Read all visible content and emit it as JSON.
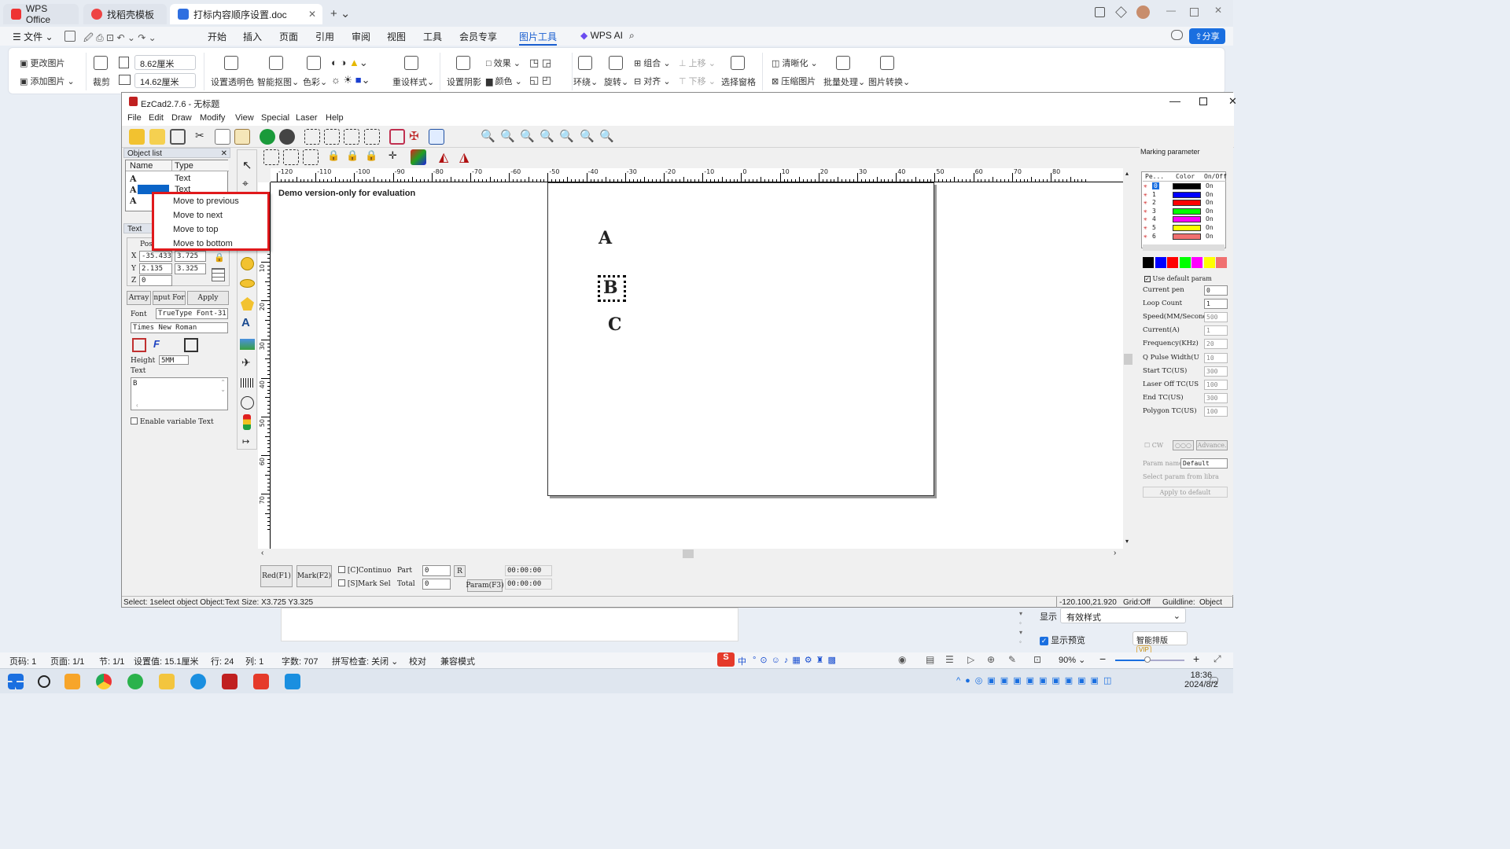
{
  "wps": {
    "tabs": [
      "WPS Office",
      "找稻壳模板",
      "打标内容顺序设置.doc"
    ],
    "menu_left": [
      "文件"
    ],
    "menu": [
      "开始",
      "插入",
      "页面",
      "引用",
      "审阅",
      "视图",
      "工具",
      "会员专享",
      "图片工具"
    ],
    "ai_label": "WPS AI",
    "share_label": "分享",
    "ribbon": {
      "change_image": "更改图片",
      "add_image": "添加图片",
      "crop": "裁剪",
      "width": "8.62厘米",
      "height": "14.62厘米",
      "set_transparent": "设置透明色",
      "smart_cutout": "智能抠图",
      "color_effect": "色彩",
      "effect": "效果",
      "color": "颜色",
      "preset_style": "重设样式",
      "set_shadow": "设置阴影",
      "wrap": "环绕",
      "rotate": "旋转",
      "group": "组合",
      "align": "对齐",
      "move_up": "上移",
      "move_down": "下移",
      "selection_pane": "选择窗格",
      "sharpen": "清晰化",
      "compress": "压缩图片",
      "batch": "批量处理",
      "convert": "图片转换"
    },
    "display_label": "显示",
    "display_value": "有效样式",
    "show_preview": "显示预览",
    "smart_layout": "智能排版",
    "vip": "VIP"
  },
  "ezcad": {
    "title": "EzCad2.7.6 - 无标题",
    "menu": [
      "File",
      "Edit",
      "Draw",
      "Modify",
      "View",
      "Special",
      "Laser",
      "Help"
    ],
    "object_list_title": "Object list",
    "columns": [
      "Name",
      "Type"
    ],
    "objects": [
      {
        "name": "A",
        "type": "Text"
      },
      {
        "name": "A",
        "type": "Text"
      },
      {
        "name": "A",
        "type": ""
      }
    ],
    "context_menu": [
      "Move to previous",
      "Move to next",
      "Move to top",
      "Move to bottom"
    ],
    "text_panel_title": "Text",
    "pos_label": "Pos",
    "x_label": "X",
    "y_label": "Y",
    "z_label": "Z",
    "x_val": "-35.433",
    "y_val": "2.135",
    "z_val": "0",
    "w_val": "3.725",
    "h_val": "3.325",
    "array_btn": "Array",
    "input_btn": "nput For",
    "apply_btn": "Apply",
    "font_label": "Font",
    "font_type": "TrueType Font-31",
    "font_name": "Times New Roman",
    "height_label": "Height",
    "height_val": "5MM",
    "text_label": "Text",
    "text_val": "B",
    "enable_var": "Enable variable Text",
    "demo_text": "Demo version-only for evaluation",
    "letters": [
      "A",
      "B",
      "C"
    ],
    "ruler_top": [
      "-120",
      "-110",
      "-100",
      "-90",
      "-80",
      "-70",
      "-60",
      "-50",
      "-40",
      "-30",
      "-20",
      "-10",
      "0",
      "10",
      "20",
      "30",
      "40",
      "50",
      "60",
      "70",
      "80"
    ],
    "ruler_left": [
      "0",
      "10",
      "20",
      "30",
      "40",
      "50",
      "60",
      "70"
    ],
    "red_btn": "Red(F1)",
    "mark_btn": "Mark(F2)",
    "continuous": "[C]Continuo",
    "mark_sel": "[S]Mark Sel",
    "part_label": "Part",
    "total_label": "Total",
    "part_val": "0",
    "total_val": "0",
    "r_btn": "R",
    "param_btn": "Param(F3)",
    "time1": "00:00:00",
    "time2": "00:00:00",
    "status_left": "Select: 1select object Object:Text Size: X3.725 Y3.325",
    "coords": "-120.100,21.920",
    "grid": "Grid:Off",
    "guideline": "Guildline:",
    "object": "Object",
    "marking_param_title": "Marking parameter",
    "pen_cols": [
      "Pe...",
      "Color",
      "On/Off"
    ],
    "pens": [
      {
        "n": "0",
        "color": "#000000",
        "on": "On"
      },
      {
        "n": "1",
        "color": "#0000ff",
        "on": "On"
      },
      {
        "n": "2",
        "color": "#ff0000",
        "on": "On"
      },
      {
        "n": "3",
        "color": "#00ff00",
        "on": "On"
      },
      {
        "n": "4",
        "color": "#ff00ff",
        "on": "On"
      },
      {
        "n": "5",
        "color": "#ffff00",
        "on": "On"
      },
      {
        "n": "6",
        "color": "#f07070",
        "on": "On"
      }
    ],
    "use_default": "Use default param",
    "params": [
      {
        "label": "Current pen",
        "val": "0"
      },
      {
        "label": "Loop Count",
        "val": "1"
      },
      {
        "label": "Speed(MM/Second",
        "val": "500"
      },
      {
        "label": "Current(A)",
        "val": "1"
      },
      {
        "label": "Frequency(KHz)",
        "val": "20"
      },
      {
        "label": "Q Pulse Width(U",
        "val": "10"
      },
      {
        "label": "Start TC(US)",
        "val": "300"
      },
      {
        "label": "Laser Off TC(US",
        "val": "100"
      },
      {
        "label": "End TC(US)",
        "val": "300"
      },
      {
        "label": "Polygon TC(US)",
        "val": "100"
      }
    ],
    "cw": "CW",
    "advance": "Advance.",
    "param_name": "Param name",
    "default": "Default",
    "select_param": "Select param from libra",
    "apply_default": "Apply to default"
  },
  "status": {
    "page": "页码: 1",
    "pages": "页面: 1/1",
    "section": "节: 1/1",
    "setting": "设置值: 15.1厘米",
    "row": "行: 24",
    "col": "列: 1",
    "words": "字数: 707",
    "spell": "拼写检查: 关闭",
    "proof": "校对",
    "compat": "兼容模式",
    "zoom": "90%",
    "ime": "中"
  },
  "taskbar": {
    "time": "18:36",
    "date": "2024/8/2"
  }
}
